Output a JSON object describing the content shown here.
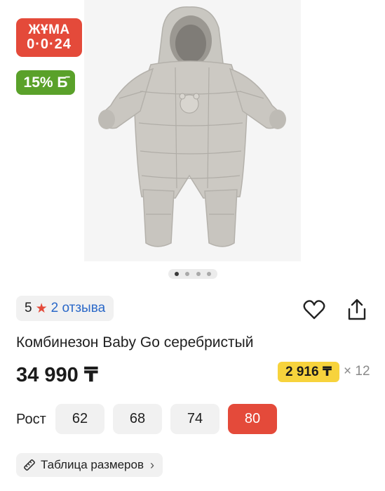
{
  "gallery": {
    "image_alt": "jumpsuit-photo",
    "slide_count": 4,
    "active_slide": 1
  },
  "badges": {
    "sale_line1": "ЖҰМА",
    "sale_line2": "0·0·24",
    "bonus": "15% Б̄"
  },
  "rating": {
    "score": "5",
    "reviews": "2 отзыва"
  },
  "product": {
    "title": "Комбинезон Baby Go серебристый",
    "price": "34 990 ₸",
    "installment_price": "2 916 ₸",
    "installment_multiplier": "× 12"
  },
  "sizes": {
    "label": "Рост",
    "options": [
      "62",
      "68",
      "74",
      "80"
    ],
    "selected": "80"
  },
  "size_table": {
    "label": "Таблица размеров"
  },
  "colors": {
    "accent": "#e44a3a",
    "bonus_green": "#5aa12a",
    "installment_yellow": "#f7d33c",
    "link_blue": "#2a68c8"
  }
}
